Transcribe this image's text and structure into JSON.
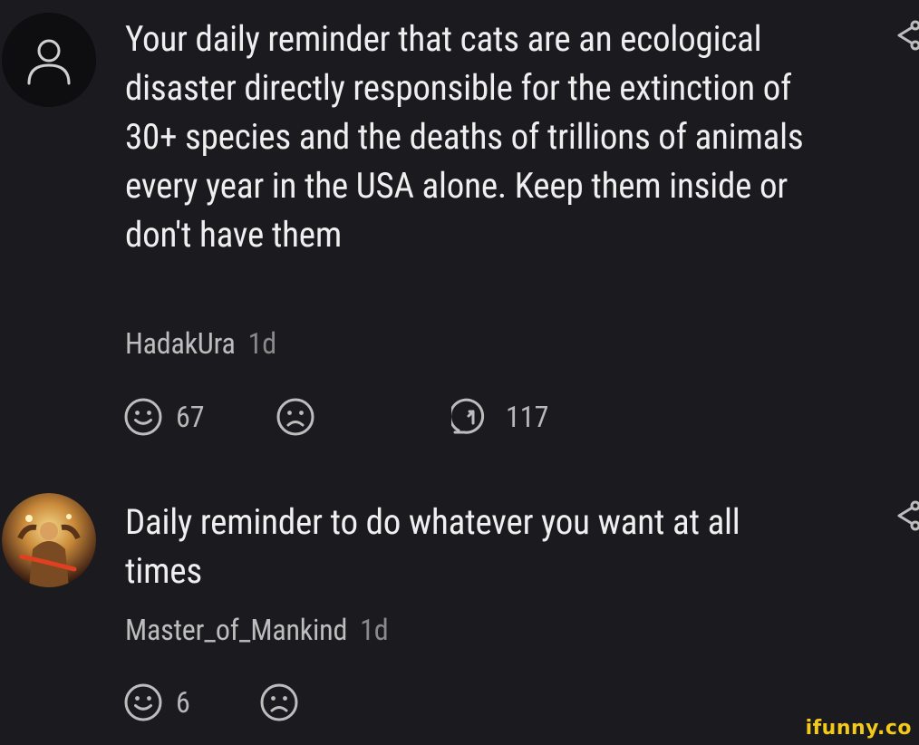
{
  "comments": [
    {
      "text": "Your daily reminder that cats are an ecological disaster directly responsible for the extinction of 30+ species and the deaths of trillions of animals every year in the USA alone. Keep them inside or don't have them",
      "author": "HadakUra",
      "age": "1d",
      "smiles": "67",
      "replies": "117",
      "avatar_icon": "user-silhouette-icon"
    },
    {
      "text": "Daily reminder to do whatever you want at all times",
      "author": "Master_of_Mankind",
      "age": "1d",
      "smiles": "6",
      "avatar_icon": "warrior-art-avatar"
    }
  ],
  "icons": {
    "smile": "smile-icon",
    "unsmile": "unsmile-icon",
    "reply": "reply-icon",
    "share": "share-icon"
  },
  "watermark": "ifunny.co",
  "colors": {
    "background": "#1b1b1f",
    "text": "#efefef",
    "muted": "#8a8a8a",
    "watermark": "#f3c91a"
  }
}
